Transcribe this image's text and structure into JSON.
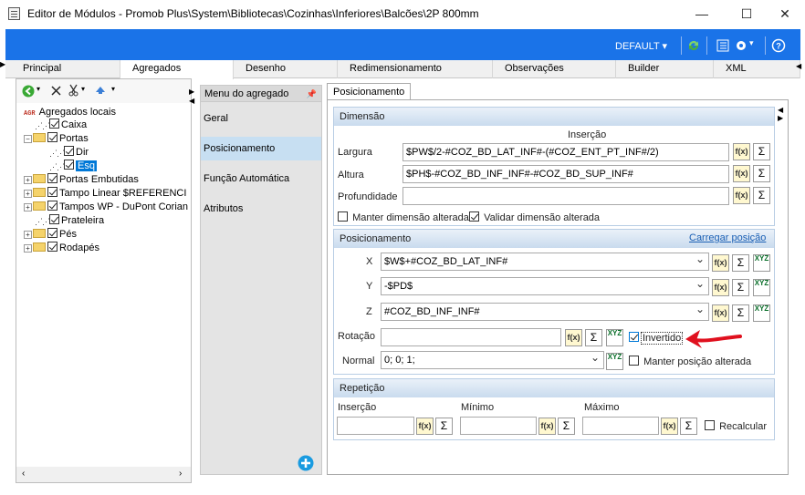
{
  "window": {
    "title": "Editor de Módulos - Promob Plus\\System\\Bibliotecas\\Cozinhas\\Inferiores\\Balcões\\2P 800mm",
    "minimize": "—",
    "maximize": "☐",
    "close": "✕"
  },
  "ribbon": {
    "profile": "DEFAULT",
    "accent": "#1a73e8"
  },
  "tabs": [
    "Principal",
    "Agregados",
    "Desenho",
    "Redimensionamento",
    "Observações",
    "Builder",
    "XML"
  ],
  "tree": {
    "root": {
      "badge": "AGR",
      "label": "Agregados locais"
    },
    "nodes": [
      "Caixa",
      "Portas",
      "Dir",
      "Esq",
      "Portas Embutidas",
      "Tampo Linear $REFERENCI",
      "Tampos WP - DuPont Corian",
      "Prateleira",
      "Pés",
      "Rodapés"
    ]
  },
  "menu": {
    "header": "Menu do agregado",
    "items": [
      "Geral",
      "Posicionamento",
      "Função Automática",
      "Atributos"
    ]
  },
  "panel": {
    "tab": "Posicionamento",
    "dimensao": {
      "title": "Dimensão",
      "column": "Inserção",
      "largura_label": "Largura",
      "largura_value": "$PW$/2-#COZ_BD_LAT_INF#-(#COZ_ENT_PT_INF#/2)",
      "altura_label": "Altura",
      "altura_value": "$PH$-#COZ_BD_INF_INF#-#COZ_BD_SUP_INF#",
      "profundidade_label": "Profundidade",
      "profundidade_value": "",
      "manter": "Manter dimensão alterada",
      "validar": "Validar dimensão alterada"
    },
    "posicionamento": {
      "title": "Posicionamento",
      "link": "Carregar posição",
      "x_label": "X",
      "x_value": "$W$+#COZ_BD_LAT_INF#",
      "y_label": "Y",
      "y_value": "-$PD$",
      "z_label": "Z",
      "z_value": "#COZ_BD_INF_INF#",
      "rotacao_label": "Rotação",
      "rotacao_value": "",
      "invertido": "Invertido",
      "normal_label": "Normal",
      "normal_value": "0; 0; 1;",
      "manter_posicao": "Manter posição alterada"
    },
    "repeticao": {
      "title": "Repetição",
      "insercao": "Inserção",
      "minimo": "Mínimo",
      "maximo": "Máximo",
      "recalcular": "Recalcular"
    }
  },
  "buttons": {
    "fx": "f(x)",
    "sigma": "Σ",
    "xyz": "XYZ"
  }
}
